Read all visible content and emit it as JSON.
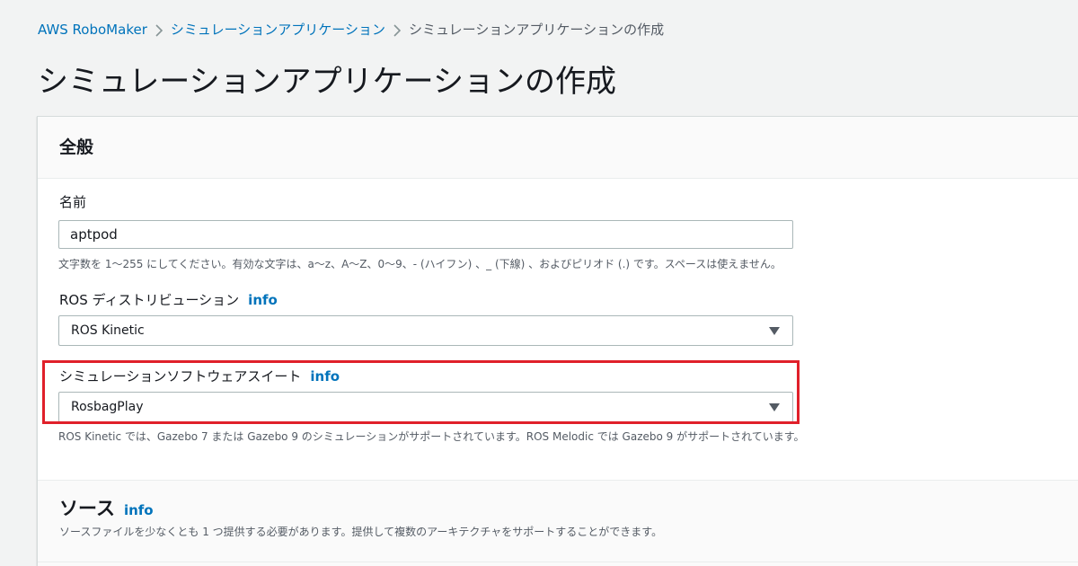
{
  "breadcrumb": {
    "root": "AWS RoboMaker",
    "parent": "シミュレーションアプリケーション",
    "current": "シミュレーションアプリケーションの作成"
  },
  "page_title": "シミュレーションアプリケーションの作成",
  "general": {
    "title": "全般",
    "name": {
      "label": "名前",
      "value": "aptpod",
      "hint": "文字数を 1〜255 にしてください。有効な文字は、a〜z、A〜Z、0〜9、- (ハイフン) 、_ (下線) 、およびピリオド (.) です。スペースは使えません。"
    },
    "ros_distribution": {
      "label": "ROS ディストリビューション",
      "info": "info",
      "selected": "ROS Kinetic"
    },
    "software_suite": {
      "label": "シミュレーションソフトウェアスイート",
      "info": "info",
      "selected": "RosbagPlay",
      "hint": "ROS Kinetic では、Gazebo 7 または Gazebo 9 のシミュレーションがサポートされています。ROS Melodic では Gazebo 9 がサポートされています。"
    }
  },
  "sources": {
    "title": "ソース",
    "info": "info",
    "description": "ソースファイルを少なくとも 1 つ提供する必要があります。提供して複数のアーキテクチャをサポートすることができます。"
  },
  "colors": {
    "link": "#0073bb",
    "highlight": "#e0202a",
    "background": "#f2f3f3"
  }
}
